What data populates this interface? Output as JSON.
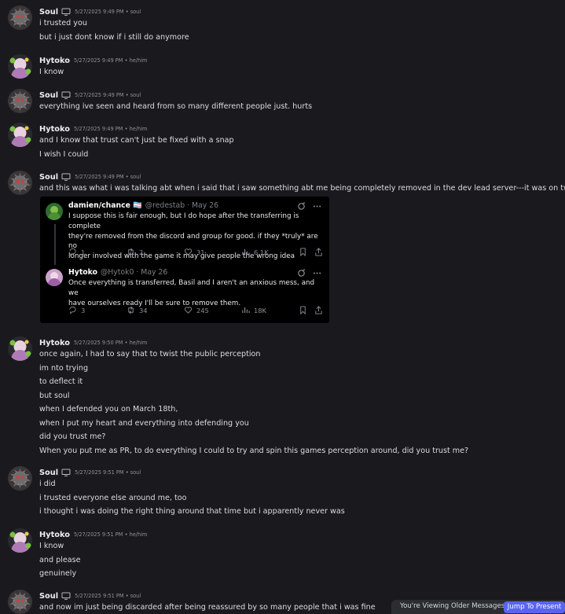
{
  "messages": [
    {
      "author": "Soul",
      "timestamp": "5/27/2025 9:49 PM",
      "pronouns": "soul",
      "device": true,
      "lines": [
        "i trusted you",
        "but i just dont know if i still do anymore"
      ]
    },
    {
      "author": "Hytoko",
      "timestamp": "5/27/2025 9:49 PM",
      "pronouns": "he/him",
      "device": false,
      "lines": [
        "I know"
      ]
    },
    {
      "author": "Soul",
      "timestamp": "5/27/2025 9:49 PM",
      "pronouns": "soul",
      "device": true,
      "lines": [
        "everything ive seen and heard from so many different people just. hurts"
      ]
    },
    {
      "author": "Hytoko",
      "timestamp": "5/27/2025 9:49 PM",
      "pronouns": "he/him",
      "device": false,
      "lines": [
        "and I know that trust can't just be fixed with a snap",
        "I wish I could"
      ]
    },
    {
      "author": "Soul",
      "timestamp": "5/27/2025 9:49 PM",
      "pronouns": "soul",
      "device": true,
      "lines": [
        "and this was what i was talking abt when i said that i saw something abt me being completely removed in the dev lead server---it was on twt"
      ]
    },
    {
      "author": "Hytoko",
      "timestamp": "5/27/2025 9:50 PM",
      "pronouns": "he/him",
      "device": false,
      "lines": [
        "once again, I had to say that to twist the public perception",
        "im nto trying",
        "to deflect it",
        "but soul",
        "when I defended you on March 18th,",
        "when I put my heart and everything into defending you",
        "did you trust me?",
        "When you put me as PR, to do everything I could to try and spin this games perception around, did you trust me?"
      ]
    },
    {
      "author": "Soul",
      "timestamp": "5/27/2025 9:51 PM",
      "pronouns": "soul",
      "device": true,
      "lines": [
        "i did",
        "i trusted everyone else around me, too",
        "i thought i was doing the right thing around that time but i apparently never was"
      ]
    },
    {
      "author": "Hytoko",
      "timestamp": "5/27/2025 9:51 PM",
      "pronouns": "he/him",
      "device": false,
      "lines": [
        "I know",
        "and please",
        "genuinely"
      ]
    },
    {
      "author": "Soul",
      "timestamp": "5/27/2025 9:51 PM",
      "pronouns": "soul",
      "device": true,
      "lines": [
        "and now im just being discarded after being reassured by so many people that i was fine"
      ]
    }
  ],
  "embed": {
    "tweets": [
      {
        "name": "damien/chance 🏳️‍⚧️",
        "handle": "@redestab",
        "date": "May 26",
        "text": [
          "I suppose this is fair enough, but I do hope after the transferring is complete",
          "they're removed from the discord and group for good. if they *truly* are no",
          "longer involved with the game it may give people the wrong idea"
        ],
        "replies": "1",
        "retweets": "2",
        "likes": "31",
        "views": "6.1K"
      },
      {
        "name": "Hytoko",
        "handle": "@Hytok0",
        "date": "May 26",
        "text": [
          "Once everything is transferred, Basil and I aren't an anxious mess, and we",
          "have ourselves ready I'll be sure to remove them."
        ],
        "replies": "3",
        "retweets": "34",
        "likes": "245",
        "views": "18K"
      }
    ]
  },
  "jump_bar": {
    "text": "You're Viewing Older Messages",
    "button": "Jump To Present"
  },
  "colors": {
    "accent": "#5865f2",
    "background": "#1a1a1e",
    "embed": "#000000"
  }
}
